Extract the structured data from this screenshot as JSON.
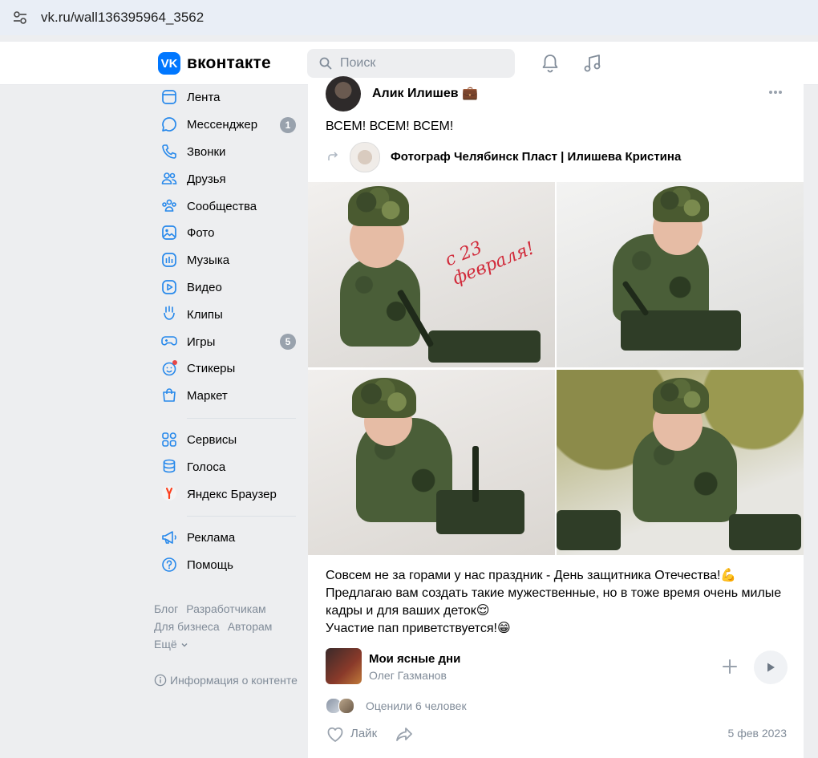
{
  "browser": {
    "url": "vk.ru/wall136395964_3562"
  },
  "header": {
    "logo_mark": "VK",
    "logo_text": "вконтакте",
    "search_placeholder": "Поиск"
  },
  "nav": {
    "items": [
      {
        "label": "Лента",
        "icon": "feed-icon"
      },
      {
        "label": "Мессенджер",
        "icon": "messenger-icon",
        "badge": "1"
      },
      {
        "label": "Звонки",
        "icon": "phone-icon"
      },
      {
        "label": "Друзья",
        "icon": "friends-icon"
      },
      {
        "label": "Сообщества",
        "icon": "communities-icon"
      },
      {
        "label": "Фото",
        "icon": "photo-icon"
      },
      {
        "label": "Музыка",
        "icon": "music-icon"
      },
      {
        "label": "Видео",
        "icon": "video-icon"
      },
      {
        "label": "Клипы",
        "icon": "clips-icon"
      },
      {
        "label": "Игры",
        "icon": "games-icon",
        "badge": "5"
      },
      {
        "label": "Стикеры",
        "icon": "stickers-icon"
      },
      {
        "label": "Маркет",
        "icon": "market-icon"
      }
    ],
    "items2": [
      {
        "label": "Сервисы",
        "icon": "services-icon"
      },
      {
        "label": "Голоса",
        "icon": "votes-icon"
      },
      {
        "label": "Яндекс Браузер",
        "icon": "yandex-icon"
      }
    ],
    "items3": [
      {
        "label": "Реклама",
        "icon": "ads-icon"
      },
      {
        "label": "Помощь",
        "icon": "help-icon"
      }
    ]
  },
  "footer": {
    "links": [
      "Блог",
      "Разработчикам",
      "Для бизнеса",
      "Авторам",
      "Ещё"
    ],
    "info": "Информация о контенте"
  },
  "post": {
    "author": "Алик Илишев 💼",
    "text": "ВСЕМ! ВСЕМ! ВСЕМ!",
    "repost_source": "Фотограф Челябинск Пласт | Илишева Кристина",
    "photo_caption": "с 23 февраля!",
    "body_lines": [
      "Совсем не за горами у нас праздник - День защитника Отечества!💪",
      "Предлагаю вам создать такие мужественные, но в тоже время очень милые кадры и для ваших деток😌",
      "Участие пап приветствуется!😁"
    ],
    "audio": {
      "title": "Мои ясные дни",
      "artist": "Олег Газманов"
    },
    "likers_text": "Оценили 6 человек",
    "like_label": "Лайк",
    "date": "5 фев 2023"
  },
  "colors": {
    "accent": "#0077ff",
    "page_bg": "#edeef0",
    "muted_text": "#818c99",
    "badge_bg": "#99a2ad",
    "nav_icon": "#2688eb"
  }
}
